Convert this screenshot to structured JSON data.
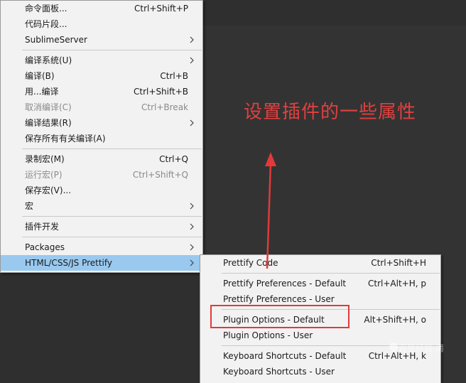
{
  "main_menu": {
    "groups": [
      [
        {
          "label": "命令面板...",
          "shortcut": "Ctrl+Shift+P"
        },
        {
          "label": "代码片段...",
          "shortcut": ""
        },
        {
          "label": "SublimeServer",
          "submenu": true
        }
      ],
      [
        {
          "label": "编译系统(U)",
          "submenu": true
        },
        {
          "label": "编译(B)",
          "shortcut": "Ctrl+B"
        },
        {
          "label": "用...编译",
          "shortcut": "Ctrl+Shift+B"
        },
        {
          "label": "取消编译(C)",
          "shortcut": "Ctrl+Break",
          "disabled": true
        },
        {
          "label": "编译结果(R)",
          "submenu": true
        },
        {
          "label": "保存所有有关编译(A)",
          "shortcut": ""
        }
      ],
      [
        {
          "label": "录制宏(M)",
          "shortcut": "Ctrl+Q"
        },
        {
          "label": "运行宏(P)",
          "shortcut": "Ctrl+Shift+Q",
          "disabled": true
        },
        {
          "label": "保存宏(V)...",
          "shortcut": ""
        },
        {
          "label": "宏",
          "submenu": true
        }
      ],
      [
        {
          "label": "插件开发",
          "submenu": true
        }
      ],
      [
        {
          "label": "Packages",
          "submenu": true
        },
        {
          "label": "HTML/CSS/JS Prettify",
          "submenu": true,
          "active": true
        }
      ]
    ]
  },
  "sub_menu": {
    "groups": [
      [
        {
          "label": "Prettify Code",
          "shortcut": "Ctrl+Shift+H"
        }
      ],
      [
        {
          "label": "Prettify Preferences - Default",
          "shortcut": "Ctrl+Alt+H, p"
        },
        {
          "label": "Prettify Preferences - User",
          "shortcut": ""
        }
      ],
      [
        {
          "label": "Plugin Options - Default",
          "shortcut": "Alt+Shift+H, o"
        },
        {
          "label": "Plugin Options - User",
          "shortcut": ""
        }
      ],
      [
        {
          "label": "Keyboard Shortcuts - Default",
          "shortcut": "Ctrl+Alt+H, k"
        },
        {
          "label": "Keyboard Shortcuts - User",
          "shortcut": ""
        }
      ]
    ]
  },
  "annotation": {
    "text": "设置插件的一些属性",
    "color": "#e04040"
  },
  "watermark": {
    "text": "百度经验·南"
  },
  "colors": {
    "menu_bg": "#f2f2f2",
    "active_bg": "#99c9ef",
    "editor_bg": "#333333"
  },
  "icons": {
    "submenu_arrow": "chevron-right-icon"
  }
}
